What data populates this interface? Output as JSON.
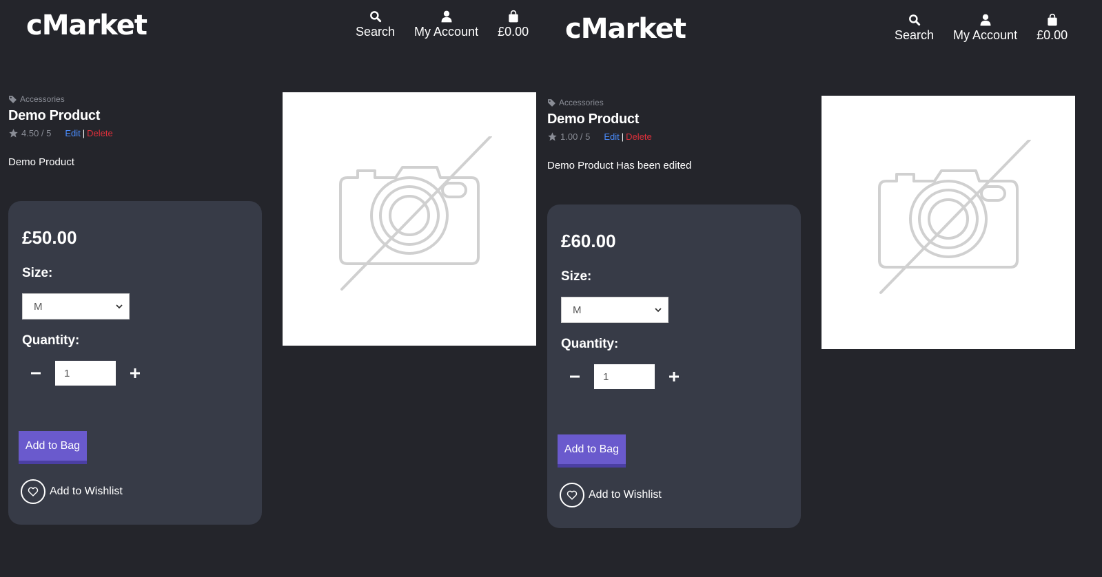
{
  "panels": [
    {
      "header": {
        "logo": "cMarket",
        "nav": [
          {
            "label": "Search",
            "icon": "search-icon"
          },
          {
            "label": "My Account",
            "icon": "user-icon"
          },
          {
            "label": "£0.00",
            "icon": "shopping-bag-icon"
          }
        ]
      },
      "product": {
        "category": "Accessories",
        "title": "Demo Product",
        "rating": "4.50 / 5",
        "edit_label": "Edit",
        "separator": "|",
        "delete_label": "Delete",
        "description": "Demo Product",
        "image_icon": "no-image-camera-icon"
      },
      "purchase": {
        "price": "£50.00",
        "size_label": "Size:",
        "size_selected": "M",
        "quantity_label": "Quantity:",
        "quantity_value": "1",
        "add_to_bag_label": "Add to Bag",
        "wishlist_label": "Add to Wishlist"
      }
    },
    {
      "header": {
        "logo": "cMarket",
        "nav": [
          {
            "label": "Search",
            "icon": "search-icon"
          },
          {
            "label": "My Account",
            "icon": "user-icon"
          },
          {
            "label": "£0.00",
            "icon": "shopping-bag-icon"
          }
        ]
      },
      "product": {
        "category": "Accessories",
        "title": "Demo Product",
        "rating": "1.00 / 5",
        "edit_label": "Edit",
        "separator": "|",
        "delete_label": "Delete",
        "description": "Demo Product Has been edited",
        "image_icon": "no-image-camera-icon"
      },
      "purchase": {
        "price": "£60.00",
        "size_label": "Size:",
        "size_selected": "M",
        "quantity_label": "Quantity:",
        "quantity_value": "1",
        "add_to_bag_label": "Add to Bag",
        "wishlist_label": "Add to Wishlist"
      }
    }
  ],
  "colors": {
    "background": "#24252b",
    "card": "#373b47",
    "accent": "#6a5acd",
    "edit_link": "#4a8dff",
    "delete_link": "#e0303b",
    "muted_text": "#8a8d96"
  }
}
